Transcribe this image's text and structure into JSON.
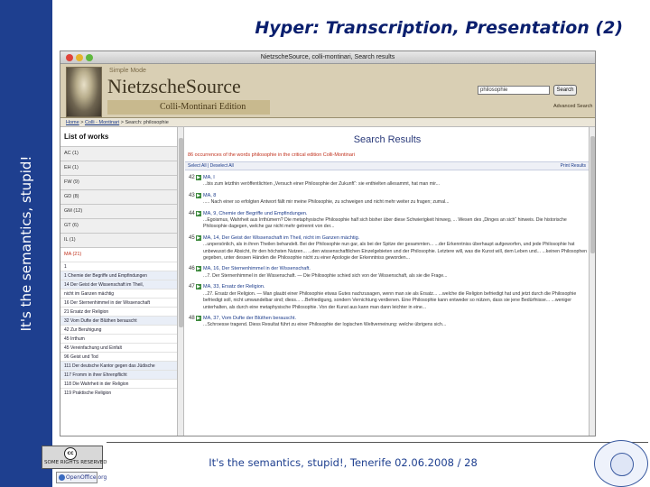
{
  "sidebar": {
    "text": "It's the semantics, stupid!"
  },
  "slide": {
    "title": "Hyper: Transcription, Presentation (2)"
  },
  "browser": {
    "window_title": "NietzscheSource, colli-montinari, Search results",
    "site_small": "Simple Mode",
    "site_name": "NietzscheSource",
    "edition": "Colli-Montinari Edition",
    "search_value": "philosophie",
    "search_button": "Search",
    "advanced_search": "Advanced Search",
    "breadcrumb": {
      "home": "Home",
      "sep1": ">",
      "colli": "Colli - Montinari",
      "sep2": "> Search: philosophie"
    }
  },
  "works": {
    "title": "List of works",
    "items": [
      {
        "label": "AC (1)"
      },
      {
        "label": "EH (1)"
      },
      {
        "label": "FW (9)"
      },
      {
        "label": "GD (8)"
      },
      {
        "label": "GM (12)"
      },
      {
        "label": "GT (6)"
      },
      {
        "label": "IL (1)"
      },
      {
        "label": "MA (21)",
        "active": true
      }
    ],
    "sub": [
      {
        "label": "1"
      },
      {
        "label": "1 Chemie der Begriffe und Empfindungen",
        "hl": true
      },
      {
        "label": "14 Der Geist der Wissenschaft im Theil,",
        "hl": true
      },
      {
        "label": "nicht im Ganzen mächtig"
      },
      {
        "label": "16 Der Sternenhimmel in der Wissenschaft"
      },
      {
        "label": "21 Ersatz der Religion"
      },
      {
        "label": "32 Vom Dufte der Blüthen berauscht",
        "hl": true
      },
      {
        "label": "42 Zur Beruhigung"
      },
      {
        "label": "45 Irrthum"
      },
      {
        "label": "45 Vereinfachung und Einfalt"
      },
      {
        "label": "96 Geist und Tod"
      },
      {
        "label": "111 Der deutsche Kantor gegen das Jüdische",
        "hl": true
      },
      {
        "label": "117 Fromm in ihrer Ehrenpflicht",
        "hl": true
      },
      {
        "label": "118 Die Wahrheit in der Religion"
      },
      {
        "label": "119 Praktische Religion"
      }
    ]
  },
  "results": {
    "title": "Search Results",
    "count": "86 occurrences of the words philosophie in the critical edition Colli-Montinari",
    "select_all": "Select All | Deselect All",
    "print": "Print Results",
    "items": [
      {
        "num": "42",
        "head": "MA, I",
        "snip": "...bis zum letzthin veröffentlichten „Versuch einer Philosophie der Zukunft“: sie enthielten allesammt, hat man mir..."
      },
      {
        "num": "43",
        "head": "MA, 8",
        "snip": "..... Nach einer so erfolgten Antwort fällt mir meine Philosophie, zu schweigen und nicht mehr weiter zu fragen; zumal..."
      },
      {
        "num": "44",
        "head": "MA, 9, Chemie der Begriffe und Empfindungen.",
        "snip": "...Egoismus, Wahrheit aus Irrthümern? Die metaphysische Philosophie half sich bisher über diese Schwierigkeit hinweg, ... Wesen des „Dinges an sich“ hinweis. Die historische Philosophie dagegen, welche gar nicht mehr getrennt von der..."
      },
      {
        "num": "45",
        "head": "MA, 14, Der Geist der Wissenschaft im Theil, nicht im Ganzen mächtig.",
        "snip": "...unpersönlich, als in ihren Theilen behandelt. Bei der Philosophie nun gar, als bei der Spitze der gesammten... ...der Erkenntniss überhaupt aufgeworfen, und jede Philosophie hat unbewusst die Absicht, ihr den höchsten Nutzen... ...den wissenschaftlichen Einzelgebieten und der Philosophie. Letztere will, was die Kunst will, dem Leben und... ...keinen Philosophen gegeben, unter dessen Händen die Philosophie nicht zu einer Apologie der Erkenntniss geworden..."
      },
      {
        "num": "46",
        "head": "MA, 16, Der Sternenhimmel in der Wissenschaft.",
        "snip": "...7. Der Sternenhimmel in der Wissenschaft. — Die Philosophie schied sich von der Wissenschaft, als sie die Frage..."
      },
      {
        "num": "47",
        "head": "MA, 33, Ersatz der Religion.",
        "snip": "...27. Ersatz der Religion. — Man glaubt einer Philosophie etwas Gutes nachzusagen, wenn man sie als Ersatz... ...welche die Religion befriedigt hat und jetzt durch die Philosophie befriedigt soll, nicht umwandelbar sind; diess... ...Befriedigung, sondern Vernichtung verdienen. Eine Philosophie kann entweder so nützen, dass sie jene Bedürfnisse... ...weniger unterhalten, als durch eine metaphysische Philosophie. Von der Kunst aus kann man dann leichter in eine..."
      },
      {
        "num": "48",
        "head": "MA, 37, Vom Dufte der Blüthen berauscht.",
        "snip": "...Schroesse tragend. Diess Resultat führt zu einer Philosophie der logischen Weltverneinung: welche übrigens sich..."
      }
    ]
  },
  "footer": {
    "text": "It's the semantics, stupid!, Tenerife 02.06.2008 / 28"
  },
  "badges": {
    "cc": "cc",
    "cc_text": "SOME RIGHTS RESERVED",
    "oo": "OpenOffice.org"
  }
}
